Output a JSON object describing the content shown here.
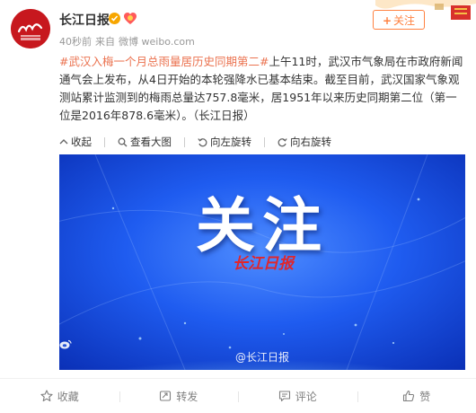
{
  "user": {
    "name": "长江日报",
    "meta_time": "40秒前",
    "meta_from": "来自",
    "meta_source": "微博 weibo.com"
  },
  "follow_button": {
    "label": "关注"
  },
  "post": {
    "topic": "#武汉入梅一个月总雨量居历史同期第二#",
    "body": "上午11时，武汉市气象局在市政府新闻通气会上发布，从4日开始的本轮强降水已基本结束。截至目前，武汉国家气象观测站累计监测到的梅雨总量达757.8毫米，居1951年以来历史同期第二位（第一位是2016年878.6毫米）。（长江日报）"
  },
  "media_toolbar": {
    "collapse": "收起",
    "view_large": "查看大图",
    "rotate_left": "向左旋转",
    "rotate_right": "向右旋转"
  },
  "image": {
    "title": "关注",
    "logo_text": "长江日报",
    "watermark": "@长江日报"
  },
  "actions": {
    "favorite": "收藏",
    "repost": "转发",
    "comment": "评论",
    "like": "赞"
  },
  "colors": {
    "accent": "#ff8140",
    "topic": "#eb7350",
    "brand_red": "#c7181e",
    "image_blue": "#0a3fd1"
  }
}
